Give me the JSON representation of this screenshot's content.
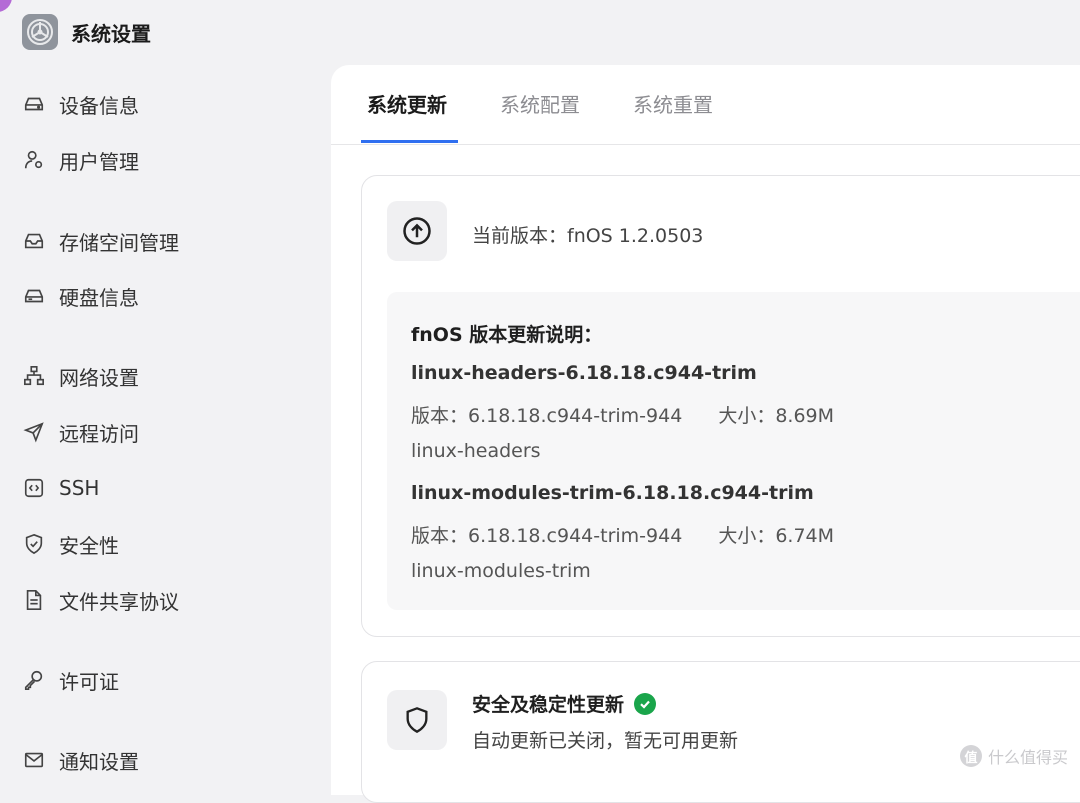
{
  "app": {
    "title": "系统设置",
    "logo_icon": "gear-logo-icon"
  },
  "sidebar": {
    "items": [
      {
        "label": "设备信息",
        "icon": "drive-icon"
      },
      {
        "label": "用户管理",
        "icon": "users-icon"
      },
      {
        "label": "存储空间管理",
        "icon": "inbox-icon"
      },
      {
        "label": "硬盘信息",
        "icon": "hard-disk-icon"
      },
      {
        "label": "网络设置",
        "icon": "network-icon"
      },
      {
        "label": "远程访问",
        "icon": "send-icon"
      },
      {
        "label": "SSH",
        "icon": "code-icon"
      },
      {
        "label": "安全性",
        "icon": "shield-check-icon"
      },
      {
        "label": "文件共享协议",
        "icon": "document-icon"
      },
      {
        "label": "许可证",
        "icon": "key-icon"
      },
      {
        "label": "通知设置",
        "icon": "mail-icon"
      }
    ]
  },
  "tabs": [
    {
      "label": "系统更新",
      "active": true
    },
    {
      "label": "系统配置",
      "active": false
    },
    {
      "label": "系统重置",
      "active": false
    }
  ],
  "update_card": {
    "icon": "upload-circle-icon",
    "current_version": "当前版本：fnOS 1.2.0503",
    "notes_title": "fnOS 版本更新说明：",
    "packages": [
      {
        "name": "linux-headers-6.18.18.c944-trim",
        "version": "版本：6.18.18.c944-trim-944",
        "size": "大小：8.69M",
        "description": "linux-headers"
      },
      {
        "name": "linux-modules-trim-6.18.18.c944-trim",
        "version": "版本：6.18.18.c944-trim-944",
        "size": "大小：6.74M",
        "description": "linux-modules-trim"
      }
    ]
  },
  "security_card": {
    "icon": "shield-icon",
    "title": "安全及稳定性更新",
    "status_icon": "check-circle-icon",
    "status_color": "#1aa54b",
    "description": "自动更新已关闭，暂无可用更新"
  },
  "watermark": {
    "symbol": "值",
    "text": "什么值得买"
  },
  "colors": {
    "accent": "#2f6ff0",
    "success": "#1aa54b"
  }
}
